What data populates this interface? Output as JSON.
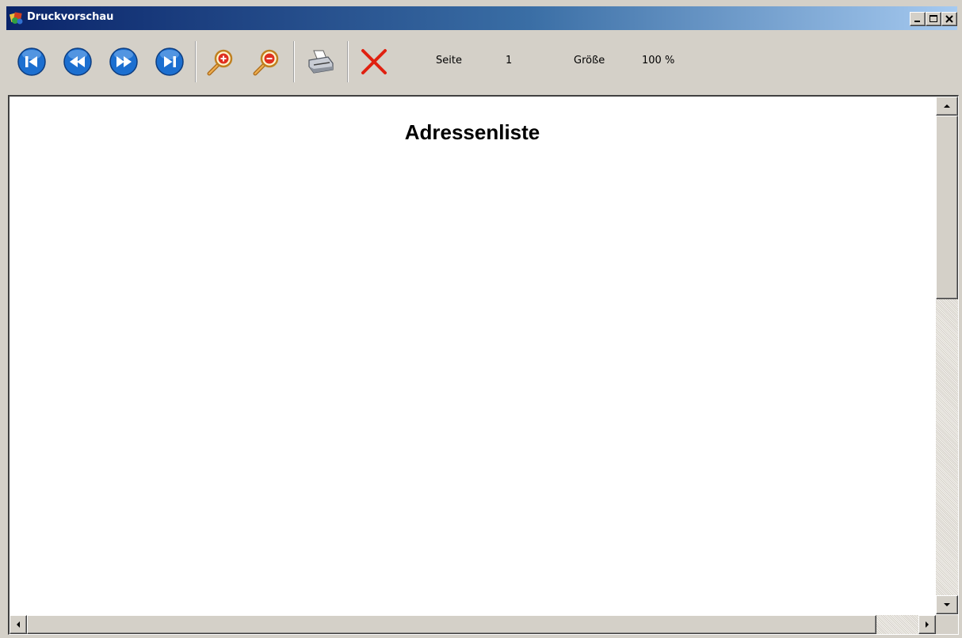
{
  "window": {
    "title": "Druckvorschau",
    "accent_colors": {
      "titlebar_start": "#0a246a",
      "titlebar_end": "#a6caf0",
      "nav_button": "#1c6fd0",
      "close_x": "#e02010",
      "face": "#d4d0c8"
    }
  },
  "titlebar_buttons": {
    "minimize": "minimize-icon",
    "maximize": "maximize-icon",
    "close": "close-icon"
  },
  "toolbar": {
    "buttons": [
      {
        "name": "first-page",
        "icon": "first-page-icon"
      },
      {
        "name": "previous-page",
        "icon": "previous-page-icon"
      },
      {
        "name": "next-page",
        "icon": "next-page-icon"
      },
      {
        "name": "last-page",
        "icon": "last-page-icon"
      },
      {
        "name": "zoom-in",
        "icon": "zoom-in-icon"
      },
      {
        "name": "zoom-out",
        "icon": "zoom-out-icon"
      },
      {
        "name": "print",
        "icon": "printer-icon"
      },
      {
        "name": "close-preview",
        "icon": "close-x-icon"
      }
    ],
    "page_label": "Seite",
    "page_value": "1",
    "size_label": "Größe",
    "size_value": "100 %"
  },
  "document": {
    "title": "Adressenliste"
  }
}
